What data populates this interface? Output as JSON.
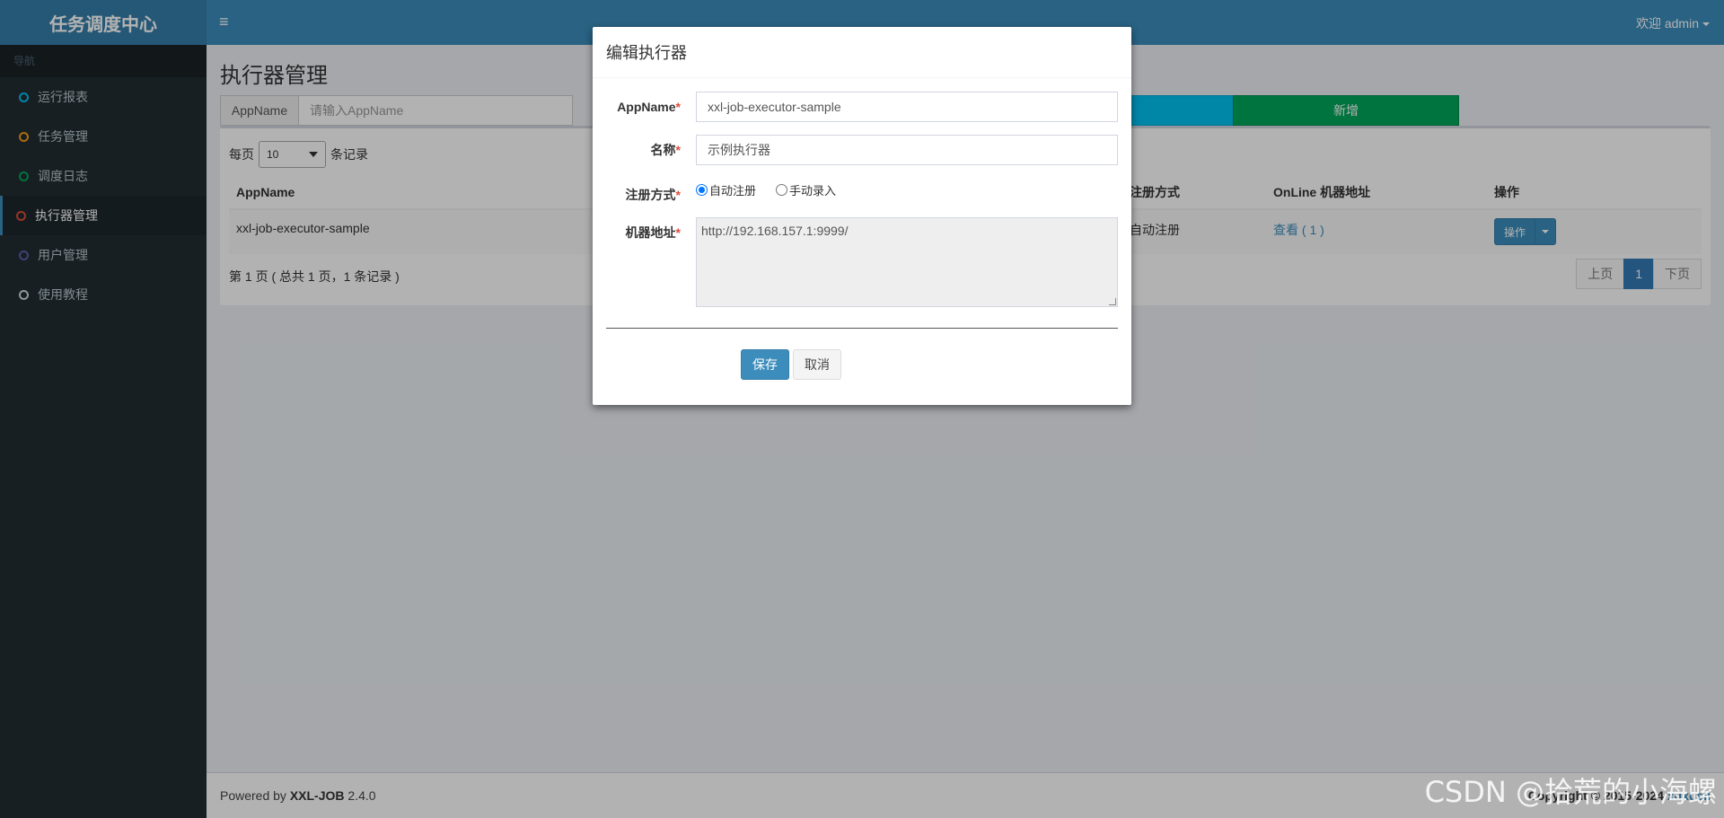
{
  "app": {
    "logo": "任务调度中心",
    "menu_toggle": "≡",
    "user_greeting": "欢迎 admin"
  },
  "sidebar": {
    "header": "导航",
    "items": [
      {
        "label": "运行报表",
        "color": "#00c0ef"
      },
      {
        "label": "任务管理",
        "color": "#f39c12"
      },
      {
        "label": "调度日志",
        "color": "#00a65a"
      },
      {
        "label": "执行器管理",
        "color": "#dd4b39",
        "active": true
      },
      {
        "label": "用户管理",
        "color": "#605ca8"
      },
      {
        "label": "使用教程",
        "color": "#d2d6de"
      }
    ]
  },
  "main": {
    "title": "执行器管理",
    "search": {
      "addon": "AppName",
      "placeholder": "请输入AppName",
      "value": ""
    },
    "add_label": "新增",
    "length": {
      "prefix": "每页",
      "value": "10",
      "suffix": "条记录"
    },
    "table": {
      "headers": [
        "AppName",
        "注册方式",
        "OnLine 机器地址",
        "操作"
      ],
      "rows": [
        {
          "appname": "xxl-job-executor-sample",
          "reg": "自动注册",
          "online": "查看 ( 1 )",
          "op": "操作"
        }
      ]
    },
    "info": "第 1 页 ( 总共 1 页，1 条记录 )",
    "pager": {
      "prev": "上页",
      "current": "1",
      "next": "下页"
    }
  },
  "footer": {
    "powered_prefix": "Powered by ",
    "brand": "XXL-JOB",
    "version": " 2.4.0",
    "copyright": "Copyright © 2015-2024",
    "author": "xuxueli"
  },
  "modal": {
    "title": "编辑执行器",
    "appname_label": "AppName",
    "appname_value": "xxl-job-executor-sample",
    "name_label": "名称",
    "name_value": "示例执行器",
    "reg_label": "注册方式",
    "reg_auto": "自动注册",
    "reg_manual": "手动录入",
    "addr_label": "机器地址",
    "addr_value": "http://192.168.157.1:9999/",
    "required_mark": "*",
    "save_label": "保存",
    "cancel_label": "取消"
  },
  "watermark": "CSDN @拾荒的小海螺"
}
